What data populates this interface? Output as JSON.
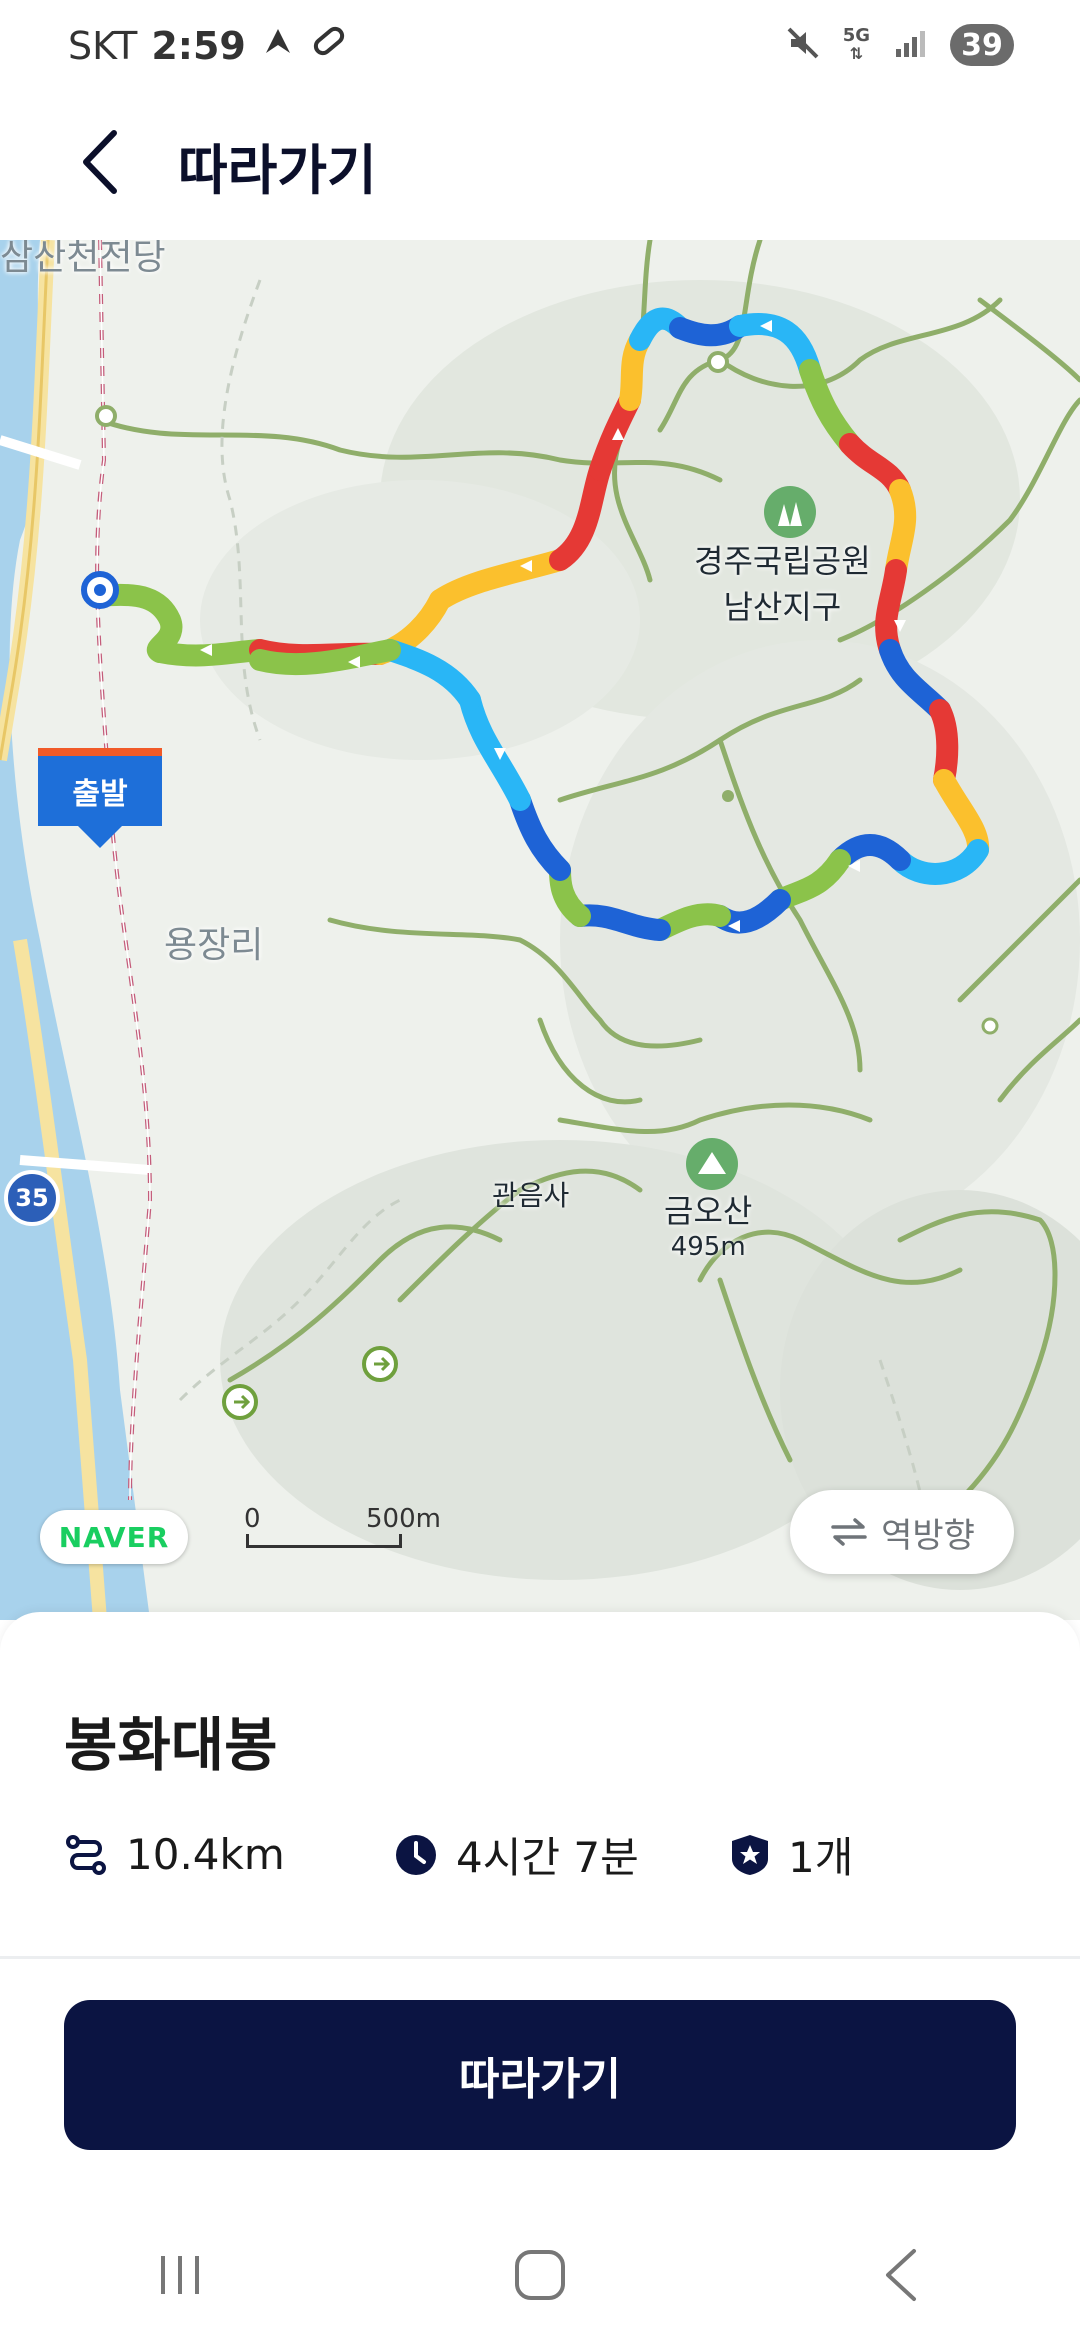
{
  "status_bar": {
    "carrier": "SKT",
    "time": "2:59",
    "network": "5G",
    "battery": "39",
    "icons": [
      "navigation-icon",
      "pill-icon",
      "mute-icon",
      "data-transfer-icon",
      "signal-icon",
      "battery-icon"
    ]
  },
  "header": {
    "back_icon": "chevron-left-icon",
    "title": "따라가기"
  },
  "map": {
    "labels": {
      "park_line1": "경주국립공원",
      "park_line2": "남산지구",
      "village": "용장리",
      "temple": "관음사",
      "peak_name": "금오산",
      "peak_elevation": "495m",
      "top_cutoff": "삼산천전당",
      "route_badge": "35"
    },
    "start_label": "출발",
    "naver_logo": "NAVER",
    "scale_zero": "0",
    "scale_distance": "500m",
    "reverse_button": "역방향",
    "reverse_icon": "swap-arrows-icon",
    "route_colors": [
      "#e53935",
      "#fbc02d",
      "#8bc34a",
      "#29b6f6",
      "#1e63d6"
    ]
  },
  "course": {
    "name": "봉화대봉",
    "distance": "10.4km",
    "duration": "4시간 7분",
    "stamps": "1개",
    "distance_icon": "route-icon",
    "duration_icon": "clock-icon",
    "stamp_icon": "star-badge-icon"
  },
  "actions": {
    "follow_label": "따라가기"
  },
  "nav_bar": {
    "buttons": [
      "recent-apps-icon",
      "home-icon",
      "back-icon"
    ]
  }
}
